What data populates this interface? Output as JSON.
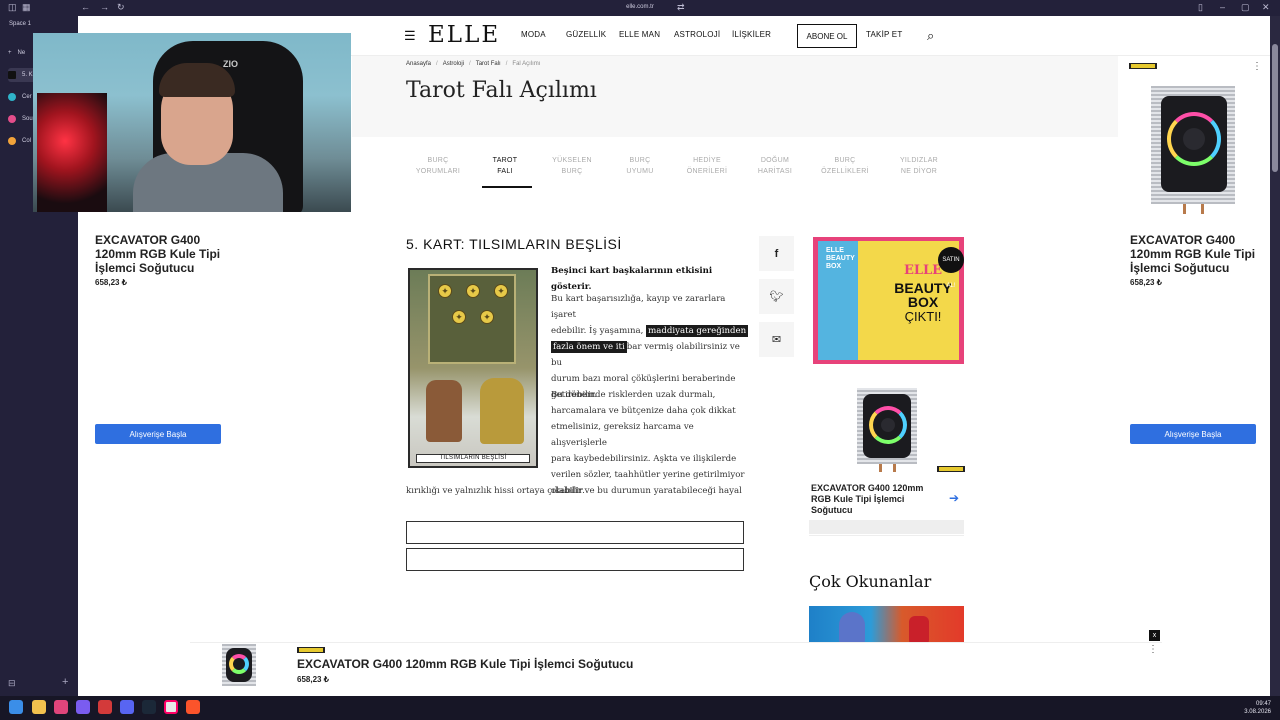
{
  "browser": {
    "url": "elle.com.tr",
    "sidebar": {
      "space_label": "Space 1",
      "new_tab_label": "Ne",
      "tabs": [
        {
          "label": "5. K",
          "active": true
        },
        {
          "label": "Cer"
        },
        {
          "label": "Sou"
        },
        {
          "label": "Col"
        }
      ]
    }
  },
  "site": {
    "logo": "ELLE",
    "nav": [
      "MODA",
      "GÜZELLİK",
      "ELLE MAN",
      "ASTROLOJİ",
      "İLİŞKİLER"
    ],
    "subscribe_label": "ABONE OL",
    "follow_label": "TAKİP ET"
  },
  "breadcrumbs": [
    "Anasayfa",
    "Astroloji",
    "Tarot Falı",
    "Fal Açılımı"
  ],
  "page_title": "Tarot Falı Açılımı",
  "tabs": [
    {
      "line1": "BURÇ",
      "line2": "YORUMLARI"
    },
    {
      "line1": "TAROT",
      "line2": "FALI",
      "active": true
    },
    {
      "line1": "YÜKSELEN",
      "line2": "BURÇ"
    },
    {
      "line1": "BURÇ",
      "line2": "UYUMU"
    },
    {
      "line1": "HEDİYE",
      "line2": "ÖNERİLERİ"
    },
    {
      "line1": "DOĞUM",
      "line2": "HARİTASI"
    },
    {
      "line1": "BURÇ",
      "line2": "ÖZELLİKLERİ"
    },
    {
      "line1": "YILDIZLAR",
      "line2": "NE DİYOR"
    }
  ],
  "article": {
    "heading": "5. KART: TILSIMLARIN BEŞLİSİ",
    "card_label": "TILSIMLARIN BEŞLİSİ",
    "lead": "Beşinci kart başkalarının etkisini gösterir.",
    "p1_a": "Bu kart başarısızlığa, kayıp ve zararlara işaret",
    "p1_b": "edebilir. İş yaşamına,",
    "p1_hl1": "maddiyata gereğinden",
    "p1_hl2": "fazla önem ve iti",
    "p1_c": "bar vermiş olabilirsiniz ve bu",
    "p1_d": "durum bazı moral çöküşlerini beraberinde",
    "p1_e": "getirebilir.",
    "p2": [
      "Bu dönemde risklerden uzak durmalı,",
      "harcamalara ve bütçenize daha çok dikkat",
      "etmelisiniz, gereksiz harcama ve alışverişlerle",
      "para kaybedebilirsiniz. Aşkta ve ilişkilerde",
      "verilen sözler, taahhütler yerine getirilmiyor",
      "olabilir ve bu durumun yaratabileceği hayal",
      "kırıklığı ve yalnızlık hissi ortaya çıkabilir."
    ]
  },
  "product": {
    "name": "EXCAVATOR G400 120mm RGB Kule Tipi İşlemci Soğutucu",
    "name_lines": [
      "EXCAVATOR G400",
      "120mm RGB Kule Tipi",
      "İşlemci Soğutucu"
    ],
    "name_lines_small": [
      "EXCAVATOR G400 120mm",
      "RGB Kule Tipi İşlemci",
      "Soğutucu"
    ],
    "price": "658,23 ₺",
    "button_label": "Alışverişe Başla"
  },
  "ad_beauty": {
    "brand": "ELLE",
    "title_line1": "BEAUTY",
    "title_line2": "BOX",
    "subtitle": "ÇIKTI!",
    "badge": "SATIN AL!",
    "corner_line1": "ELLE",
    "corner_line2": "BEAUTY",
    "corner_line3": "BOX"
  },
  "most_read_heading": "Çok Okunanlar",
  "sticky_close": "x",
  "clock": {
    "time": "09:47",
    "date": "3.08.2026"
  },
  "colors": {
    "accent_blue": "#2f6fe0",
    "text": "#111111"
  }
}
